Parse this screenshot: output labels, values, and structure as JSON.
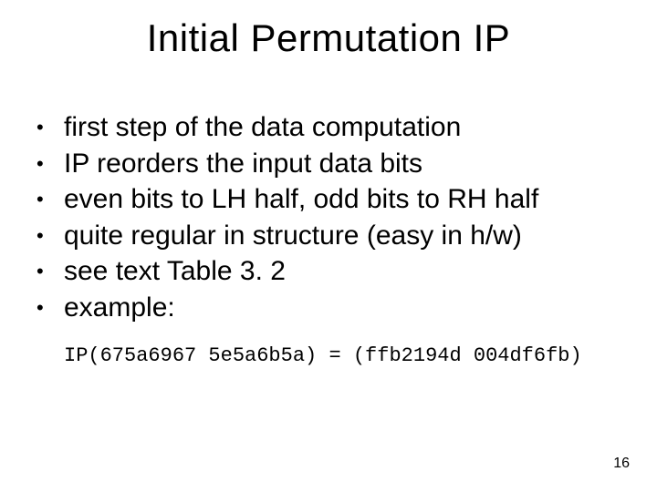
{
  "title": "Initial Permutation IP",
  "bullets": [
    "first step of the data computation",
    "IP reorders the input data bits",
    "even bits to LH half, odd bits to RH half",
    "quite regular in structure (easy in h/w)",
    "see text Table 3. 2",
    "example:"
  ],
  "bullet_marker": "•",
  "code_example": "IP(675a6967 5e5a6b5a) = (ffb2194d 004df6fb)",
  "page_number": "16"
}
